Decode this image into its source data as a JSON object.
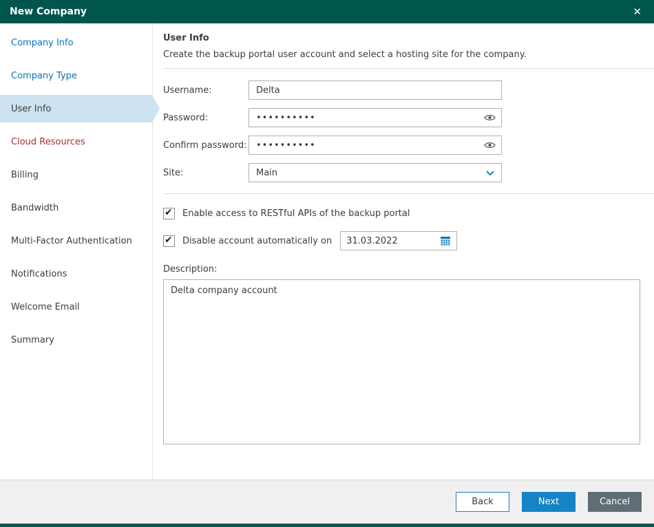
{
  "window": {
    "title": "New Company",
    "close_icon": "✕"
  },
  "sidebar": {
    "items": [
      {
        "label": "Company Info",
        "state": "completed"
      },
      {
        "label": "Company Type",
        "state": "completed"
      },
      {
        "label": "User Info",
        "state": "current"
      },
      {
        "label": "Cloud Resources",
        "state": "alert"
      },
      {
        "label": "Billing",
        "state": "upcoming"
      },
      {
        "label": "Bandwidth",
        "state": "upcoming"
      },
      {
        "label": "Multi-Factor Authentication",
        "state": "upcoming"
      },
      {
        "label": "Notifications",
        "state": "upcoming"
      },
      {
        "label": "Welcome Email",
        "state": "upcoming"
      },
      {
        "label": "Summary",
        "state": "upcoming"
      }
    ]
  },
  "content": {
    "heading": "User Info",
    "subheading": "Create the backup portal user account and select a hosting site for the company.",
    "fields": {
      "username": {
        "label": "Username:",
        "value": "Delta"
      },
      "password": {
        "label": "Password:",
        "value": "••••••••••"
      },
      "confirm_password": {
        "label": "Confirm password:",
        "value": "••••••••••"
      },
      "site": {
        "label": "Site:",
        "value": "Main"
      }
    },
    "checkboxes": {
      "rest_api": {
        "label": "Enable access to RESTful APIs of the backup portal",
        "checked": true
      },
      "disable_account": {
        "label": "Disable account automatically on",
        "checked": true,
        "date_value": "31.03.2022"
      }
    },
    "description": {
      "label": "Description:",
      "value": "Delta company account"
    }
  },
  "footer": {
    "back_label": "Back",
    "next_label": "Next",
    "cancel_label": "Cancel"
  },
  "colors": {
    "titlebar": "#00564d",
    "accent_blue": "#1583c5",
    "link_blue": "#0c72b8",
    "alert_red": "#a22f2f",
    "selected_bg": "#cde3f2",
    "cancel_gray": "#5f6e74"
  }
}
